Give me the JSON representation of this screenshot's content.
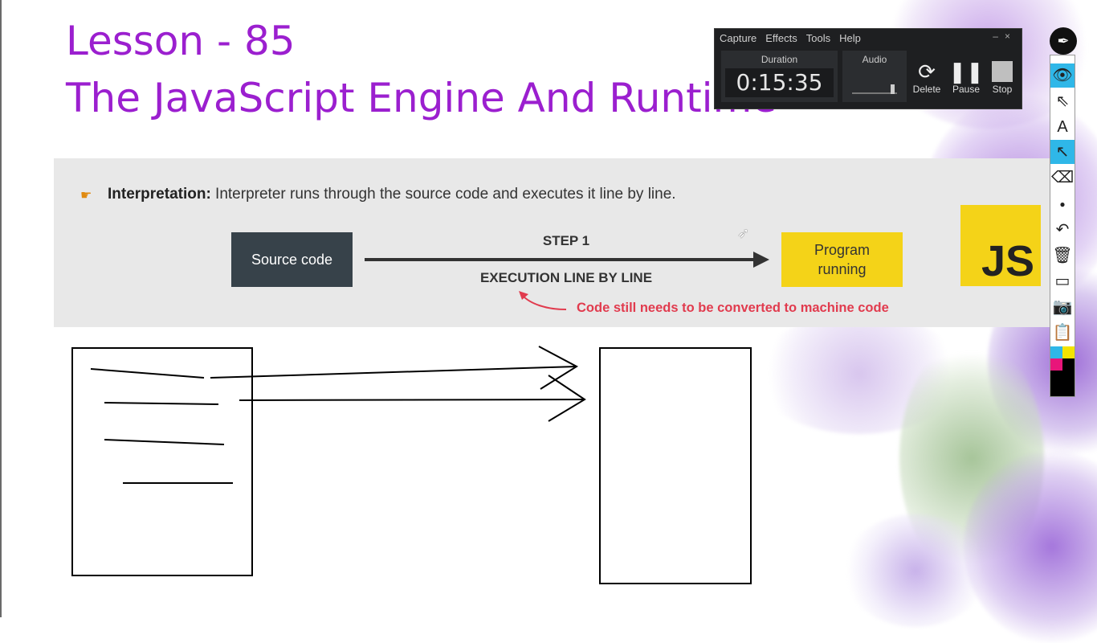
{
  "lesson": {
    "line1": "Lesson - 85",
    "line2": "The JavaScript Engine And Runtime"
  },
  "slide": {
    "interpretation_label": "Interpretation:",
    "interpretation_text": " Interpreter runs through the source code and executes it line by line.",
    "source_box": "Source code",
    "program_box_line1": "Program",
    "program_box_line2": "running",
    "step": "STEP 1",
    "execution": "EXECUTION LINE BY LINE",
    "note": "Code still needs to be converted to machine code",
    "logo": "JS",
    "colors": {
      "source_box": "#37424a",
      "program_box": "#f4d318",
      "note": "#e13b4e",
      "title": "#9b1fcf"
    }
  },
  "recorder": {
    "menu": [
      "Capture",
      "Effects",
      "Tools",
      "Help"
    ],
    "window_controls": [
      "–",
      "×"
    ],
    "duration_label": "Duration",
    "duration_value": "0:15:35",
    "audio_label": "Audio",
    "buttons": [
      {
        "label": "Delete",
        "icon": "restart-icon"
      },
      {
        "label": "Pause",
        "icon": "pause-icon"
      },
      {
        "label": "Stop",
        "icon": "stop-icon"
      }
    ]
  },
  "toolbar": {
    "tools": [
      "pen-logo-icon",
      "eye-icon",
      "select-arrow-icon",
      "text-icon",
      "arrow-draw-icon",
      "eraser-icon",
      "dot-size-icon",
      "undo-icon",
      "trash-icon",
      "board-icon",
      "camera-icon",
      "clipboard-icon"
    ],
    "palette_colors": [
      "#2fb7e8",
      "#f4e300",
      "#e8157a",
      "#000000"
    ]
  }
}
